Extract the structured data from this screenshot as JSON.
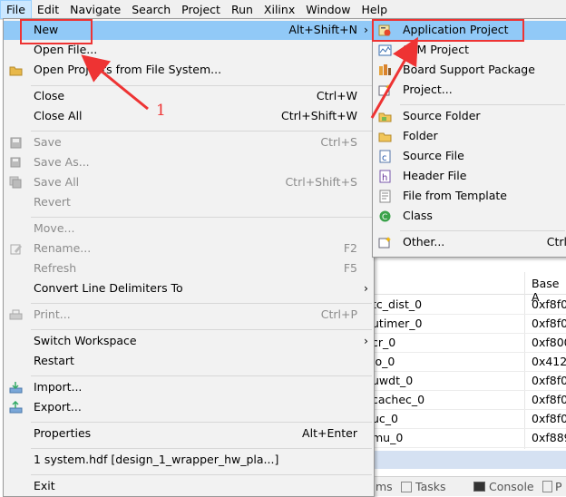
{
  "menubar": {
    "items": [
      "File",
      "Edit",
      "Navigate",
      "Search",
      "Project",
      "Run",
      "Xilinx",
      "Window",
      "Help"
    ]
  },
  "file_menu": {
    "new": {
      "label": "New",
      "shortcut": "Alt+Shift+N",
      "arrow": "›"
    },
    "open_file": "Open File...",
    "open_projects": "Open Projects from File System...",
    "close": {
      "label": "Close",
      "shortcut": "Ctrl+W"
    },
    "close_all": {
      "label": "Close All",
      "shortcut": "Ctrl+Shift+W"
    },
    "save": {
      "label": "Save",
      "shortcut": "Ctrl+S"
    },
    "save_as": "Save As...",
    "save_all": {
      "label": "Save All",
      "shortcut": "Ctrl+Shift+S"
    },
    "revert": "Revert",
    "move": "Move...",
    "rename": {
      "label": "Rename...",
      "shortcut": "F2"
    },
    "refresh": {
      "label": "Refresh",
      "shortcut": "F5"
    },
    "convert": {
      "label": "Convert Line Delimiters To",
      "arrow": "›"
    },
    "print": {
      "label": "Print...",
      "shortcut": "Ctrl+P"
    },
    "switch_ws": {
      "label": "Switch Workspace",
      "arrow": "›"
    },
    "restart": "Restart",
    "import": "Import...",
    "export": "Export...",
    "properties": {
      "label": "Properties",
      "shortcut": "Alt+Enter"
    },
    "recent": "1 system.hdf  [design_1_wrapper_hw_pla...]",
    "exit": "Exit"
  },
  "new_menu": {
    "app_project": "Application Project",
    "spm_project": "SPM Project",
    "bsp": "Board Support Package",
    "project": "Project...",
    "source_folder": "Source Folder",
    "folder": "Folder",
    "source_file": "Source File",
    "header_file": "Header File",
    "file_template": "File from Template",
    "class": "Class",
    "other": {
      "label": "Other...",
      "shortcut": "Ctrl"
    }
  },
  "annotation": {
    "number": "1"
  },
  "background": {
    "header_col2": "Base A",
    "rows": [
      {
        "c1": "tc_dist_0",
        "c2": "0xf8f0"
      },
      {
        "c1": "utimer_0",
        "c2": "0xf8f0"
      },
      {
        "c1": "cr_0",
        "c2": "0xf800"
      },
      {
        "c1": "io_0",
        "c2": "0x4120"
      },
      {
        "c1": "uwdt_0",
        "c2": "0xf8f0"
      },
      {
        "c1": "cachec_0",
        "c2": "0xf8f0"
      },
      {
        "c1": "uc_0",
        "c2": "0xf8f0"
      },
      {
        "c1": "mu_0",
        "c2": "0xf889"
      }
    ],
    "tabs": {
      "problems": "ms",
      "tasks": "Tasks",
      "console": "Console",
      "props": "P"
    }
  }
}
